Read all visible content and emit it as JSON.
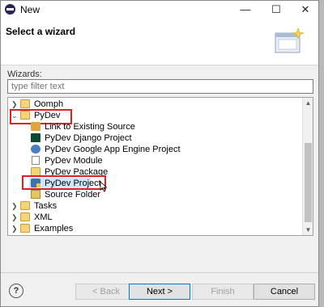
{
  "window": {
    "title": "New",
    "controls": {
      "minimize": "—",
      "maximize": "☐",
      "close": "✕"
    }
  },
  "banner": {
    "heading": "Select a wizard"
  },
  "wizards_label": "Wizards:",
  "filter": {
    "placeholder": "type filter text",
    "value": ""
  },
  "tree": {
    "items": [
      {
        "label": "Oomph",
        "icon": "folder-icon",
        "expanded": false,
        "level": 0
      },
      {
        "label": "PyDev",
        "icon": "folder-open-icon",
        "expanded": true,
        "level": 0,
        "highlighted": true
      },
      {
        "label": "Link to Existing Source",
        "icon": "link-source-icon",
        "level": 1
      },
      {
        "label": "PyDev Django Project",
        "icon": "django-icon",
        "level": 1
      },
      {
        "label": "PyDev Google App Engine Project",
        "icon": "app-engine-icon",
        "level": 1
      },
      {
        "label": "PyDev Module",
        "icon": "module-icon",
        "level": 1
      },
      {
        "label": "PyDev Package",
        "icon": "package-icon",
        "level": 1
      },
      {
        "label": "PyDev Project",
        "icon": "python-project-icon",
        "level": 1,
        "selected": true,
        "highlighted": true
      },
      {
        "label": "Source Folder",
        "icon": "source-folder-icon",
        "level": 1
      },
      {
        "label": "Tasks",
        "icon": "folder-icon",
        "expanded": false,
        "level": 0
      },
      {
        "label": "XML",
        "icon": "folder-icon",
        "expanded": false,
        "level": 0
      },
      {
        "label": "Examples",
        "icon": "folder-icon",
        "expanded": false,
        "level": 0
      }
    ]
  },
  "buttons": {
    "back": "< Back",
    "next": "Next >",
    "finish": "Finish",
    "cancel": "Cancel",
    "help": "?"
  },
  "colors": {
    "highlight_box": "#e02020",
    "selection": "#cce8ff",
    "default_button_border": "#0078d7"
  }
}
